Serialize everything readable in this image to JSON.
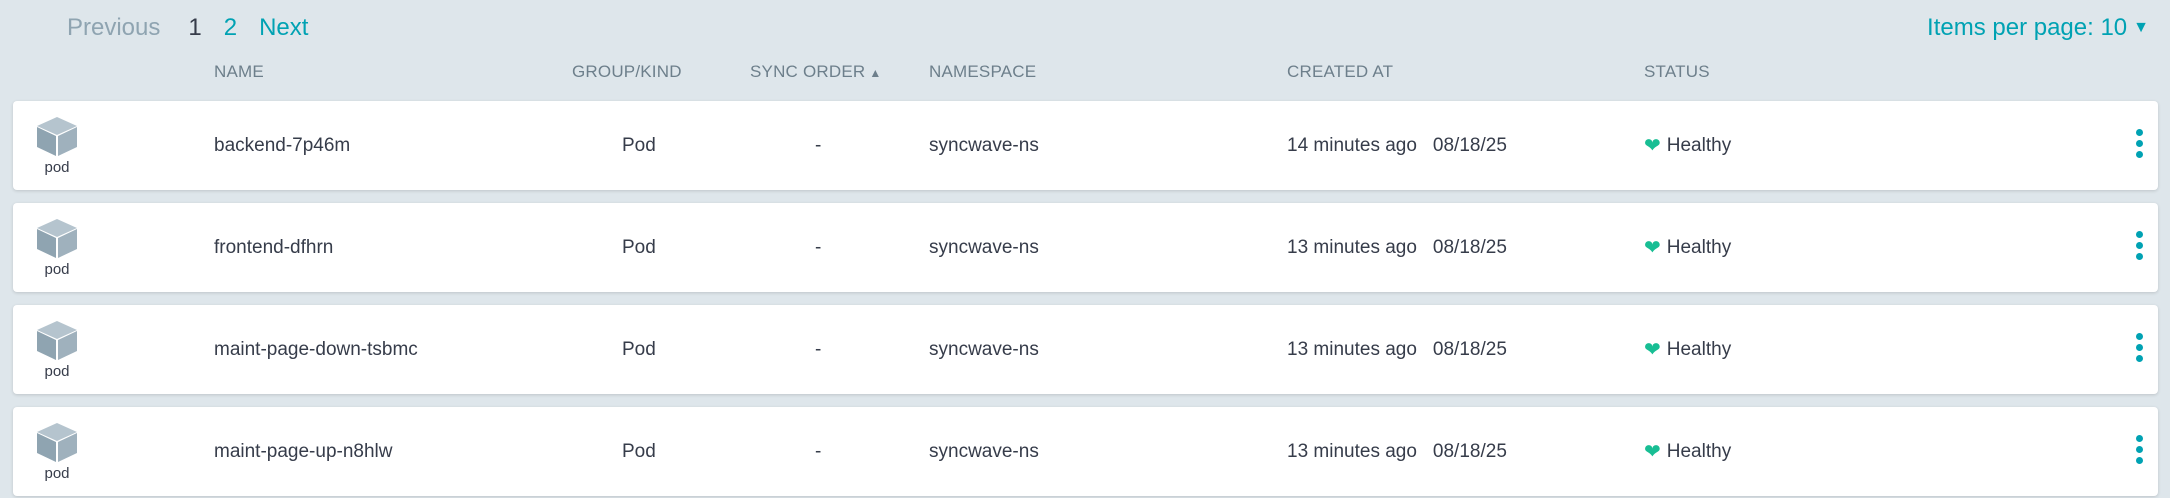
{
  "pagination": {
    "previous_label": "Previous",
    "pages": [
      "1",
      "2"
    ],
    "current_page": "1",
    "next_label": "Next",
    "items_per_page_label": "Items per page: 10"
  },
  "columns": {
    "name": "NAME",
    "group_kind": "GROUP/KIND",
    "sync_order": "SYNC ORDER",
    "namespace": "NAMESPACE",
    "created_at": "CREATED AT",
    "status": "STATUS"
  },
  "rows": [
    {
      "kind_icon_label": "pod",
      "name": "backend-7p46m",
      "kind": "Pod",
      "sync_order": "-",
      "namespace": "syncwave-ns",
      "age": "14 minutes ago",
      "date": "08/18/25",
      "status": "Healthy"
    },
    {
      "kind_icon_label": "pod",
      "name": "frontend-dfhrn",
      "kind": "Pod",
      "sync_order": "-",
      "namespace": "syncwave-ns",
      "age": "13 minutes ago",
      "date": "08/18/25",
      "status": "Healthy"
    },
    {
      "kind_icon_label": "pod",
      "name": "maint-page-down-tsbmc",
      "kind": "Pod",
      "sync_order": "-",
      "namespace": "syncwave-ns",
      "age": "13 minutes ago",
      "date": "08/18/25",
      "status": "Healthy"
    },
    {
      "kind_icon_label": "pod",
      "name": "maint-page-up-n8hlw",
      "kind": "Pod",
      "sync_order": "-",
      "namespace": "syncwave-ns",
      "age": "13 minutes ago",
      "date": "08/18/25",
      "status": "Healthy"
    }
  ],
  "colors": {
    "accent": "#00a2b3",
    "healthy": "#18be94",
    "icon": "#8fa4b1"
  }
}
